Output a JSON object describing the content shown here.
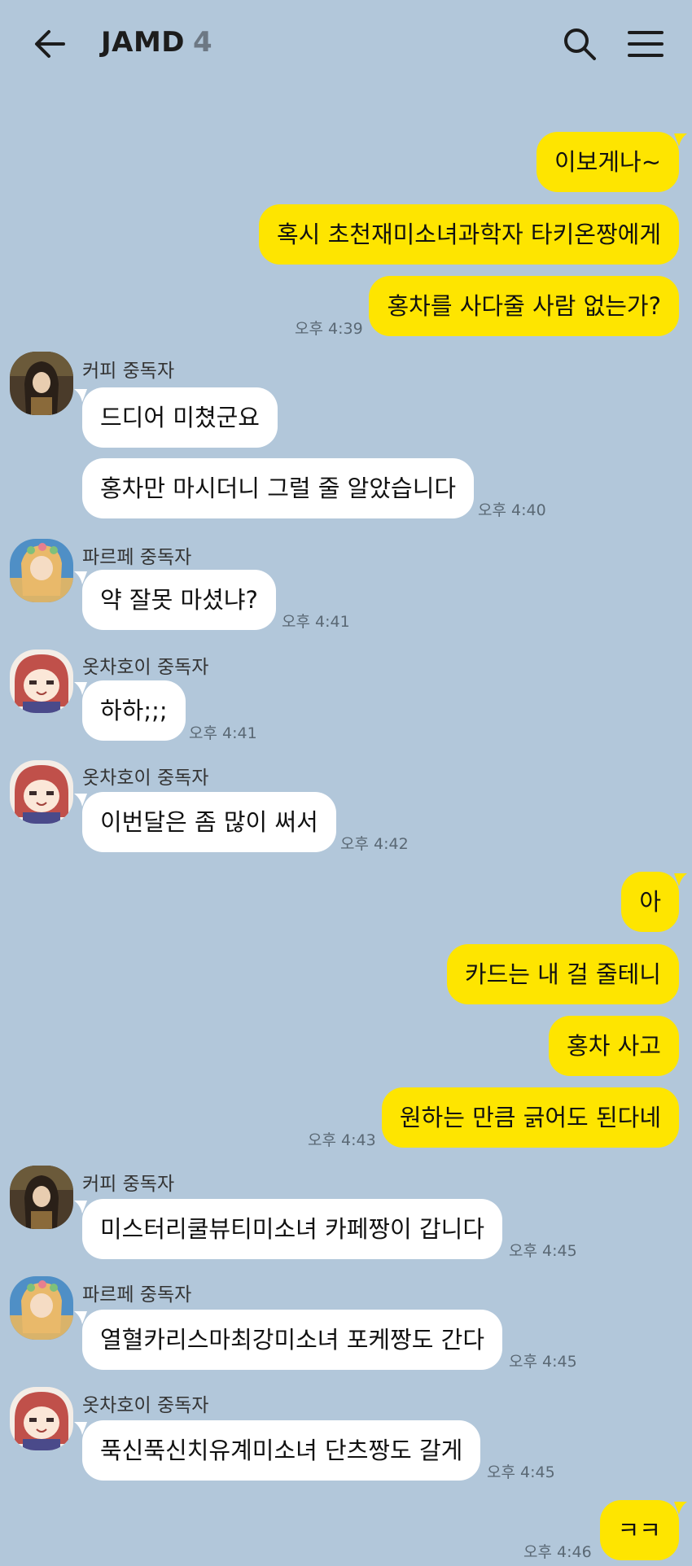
{
  "header": {
    "title": "JAMD",
    "member_count": "4"
  },
  "senders": {
    "coffee": "커피 중독자",
    "parfait": "파르페 중독자",
    "otchahoi": "옷차호이 중독자"
  },
  "messages": {
    "m1": "이보게나~",
    "m2": "혹시 초천재미소녀과학자 타키온짱에게",
    "m3": "홍차를 사다줄 사람 없는가?",
    "t3": "오후 4:39",
    "m4": "드디어 미쳤군요",
    "m5": "홍차만 마시더니 그럴 줄 알았습니다",
    "t5": "오후 4:40",
    "m6": "약 잘못 마셨냐?",
    "t6": "오후 4:41",
    "m7": "하하;;;",
    "t7": "오후 4:41",
    "m8": "이번달은 좀 많이 써서",
    "t8": "오후 4:42",
    "m9": "아",
    "m10": "카드는 내 걸 줄테니",
    "m11": "홍차 사고",
    "m12": "원하는 만큼 긁어도 된다네",
    "t12": "오후 4:43",
    "m13": "미스터리쿨뷰티미소녀 카페짱이 갑니다",
    "t13": "오후 4:45",
    "m14": "열혈카리스마최강미소녀 포케짱도 간다",
    "t14": "오후 4:45",
    "m15": "푹신푹신치유계미소녀 단츠짱도 갈게",
    "t15": "오후 4:45",
    "m16": "ㅋㅋ",
    "t16": "오후 4:46"
  },
  "colors": {
    "background": "#b2c7da",
    "my_bubble": "#fee500",
    "other_bubble": "#ffffff"
  },
  "icons": [
    "back-arrow-icon",
    "search-icon",
    "menu-icon"
  ]
}
